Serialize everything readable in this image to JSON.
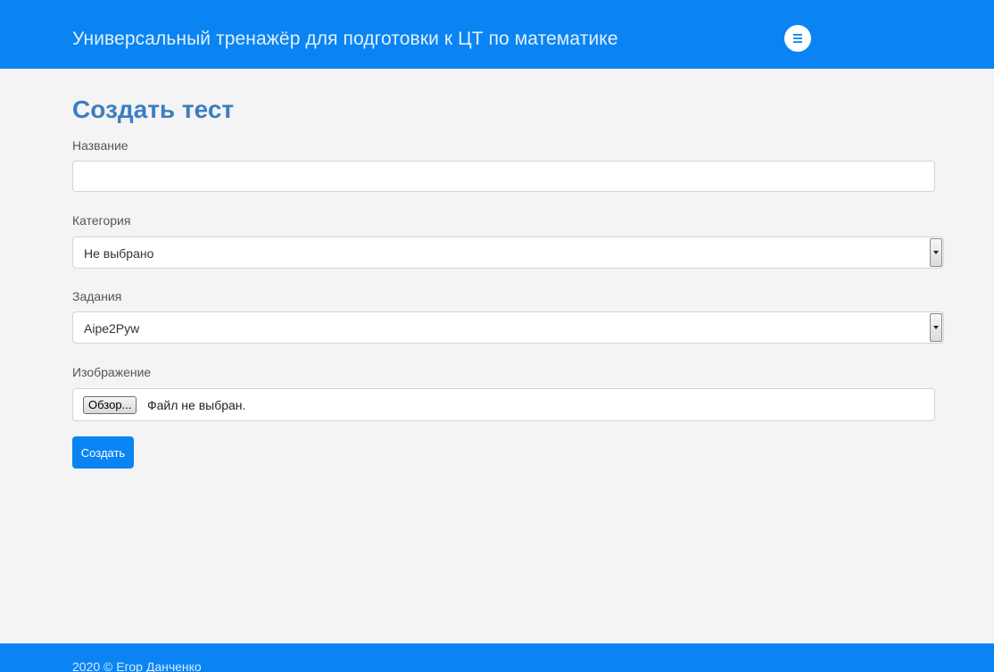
{
  "navbar": {
    "brand": "Универсальный тренажёр для подготовки к ЦТ по математике",
    "menu_icon": "hamburger-icon",
    "accent_color": "#0a84f3"
  },
  "form": {
    "title": "Создать тест",
    "name": {
      "label": "Название",
      "value": ""
    },
    "category": {
      "label": "Категория",
      "selected": "Не выбрано"
    },
    "tasks": {
      "label": "Задания",
      "selected": "Aipe2Pyw"
    },
    "image": {
      "label": "Изображение",
      "browse_label": "Обзор...",
      "status": "Файл не выбран."
    },
    "submit_label": "Создать"
  },
  "footer": {
    "text": "2020 © Егор Данченко"
  }
}
